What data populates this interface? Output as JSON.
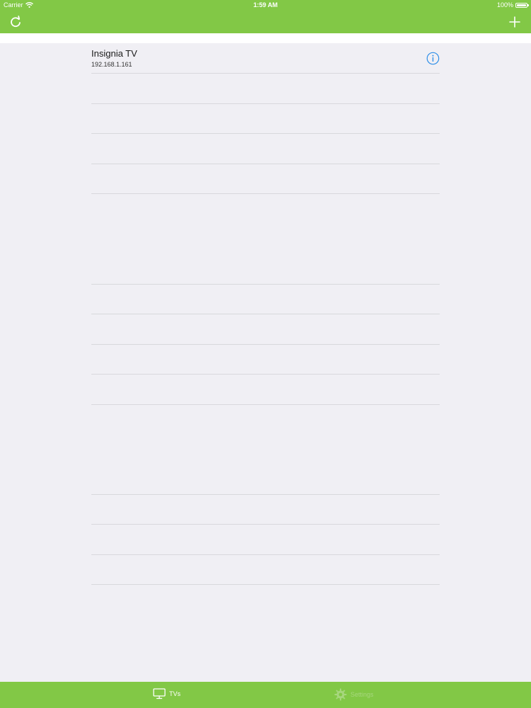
{
  "status_bar": {
    "carrier": "Carrier",
    "time": "1:59 AM",
    "battery": "100%"
  },
  "nav": {
    "left_icon": "refresh-icon",
    "right_icon": "plus-icon"
  },
  "devices": [
    {
      "name": "Insignia TV",
      "ip": "192.168.1.161",
      "accessory_icon": "info-icon"
    }
  ],
  "tabbar": {
    "tabs": [
      {
        "label": "TVs",
        "icon": "tv-icon",
        "selected": true
      },
      {
        "label": "Settings",
        "icon": "gear-icon",
        "selected": false
      }
    ]
  },
  "colors": {
    "bar_green": "#82c846",
    "background": "#f0eff4",
    "info_blue": "#2f8fe8",
    "separator": "#d8d8dc"
  }
}
